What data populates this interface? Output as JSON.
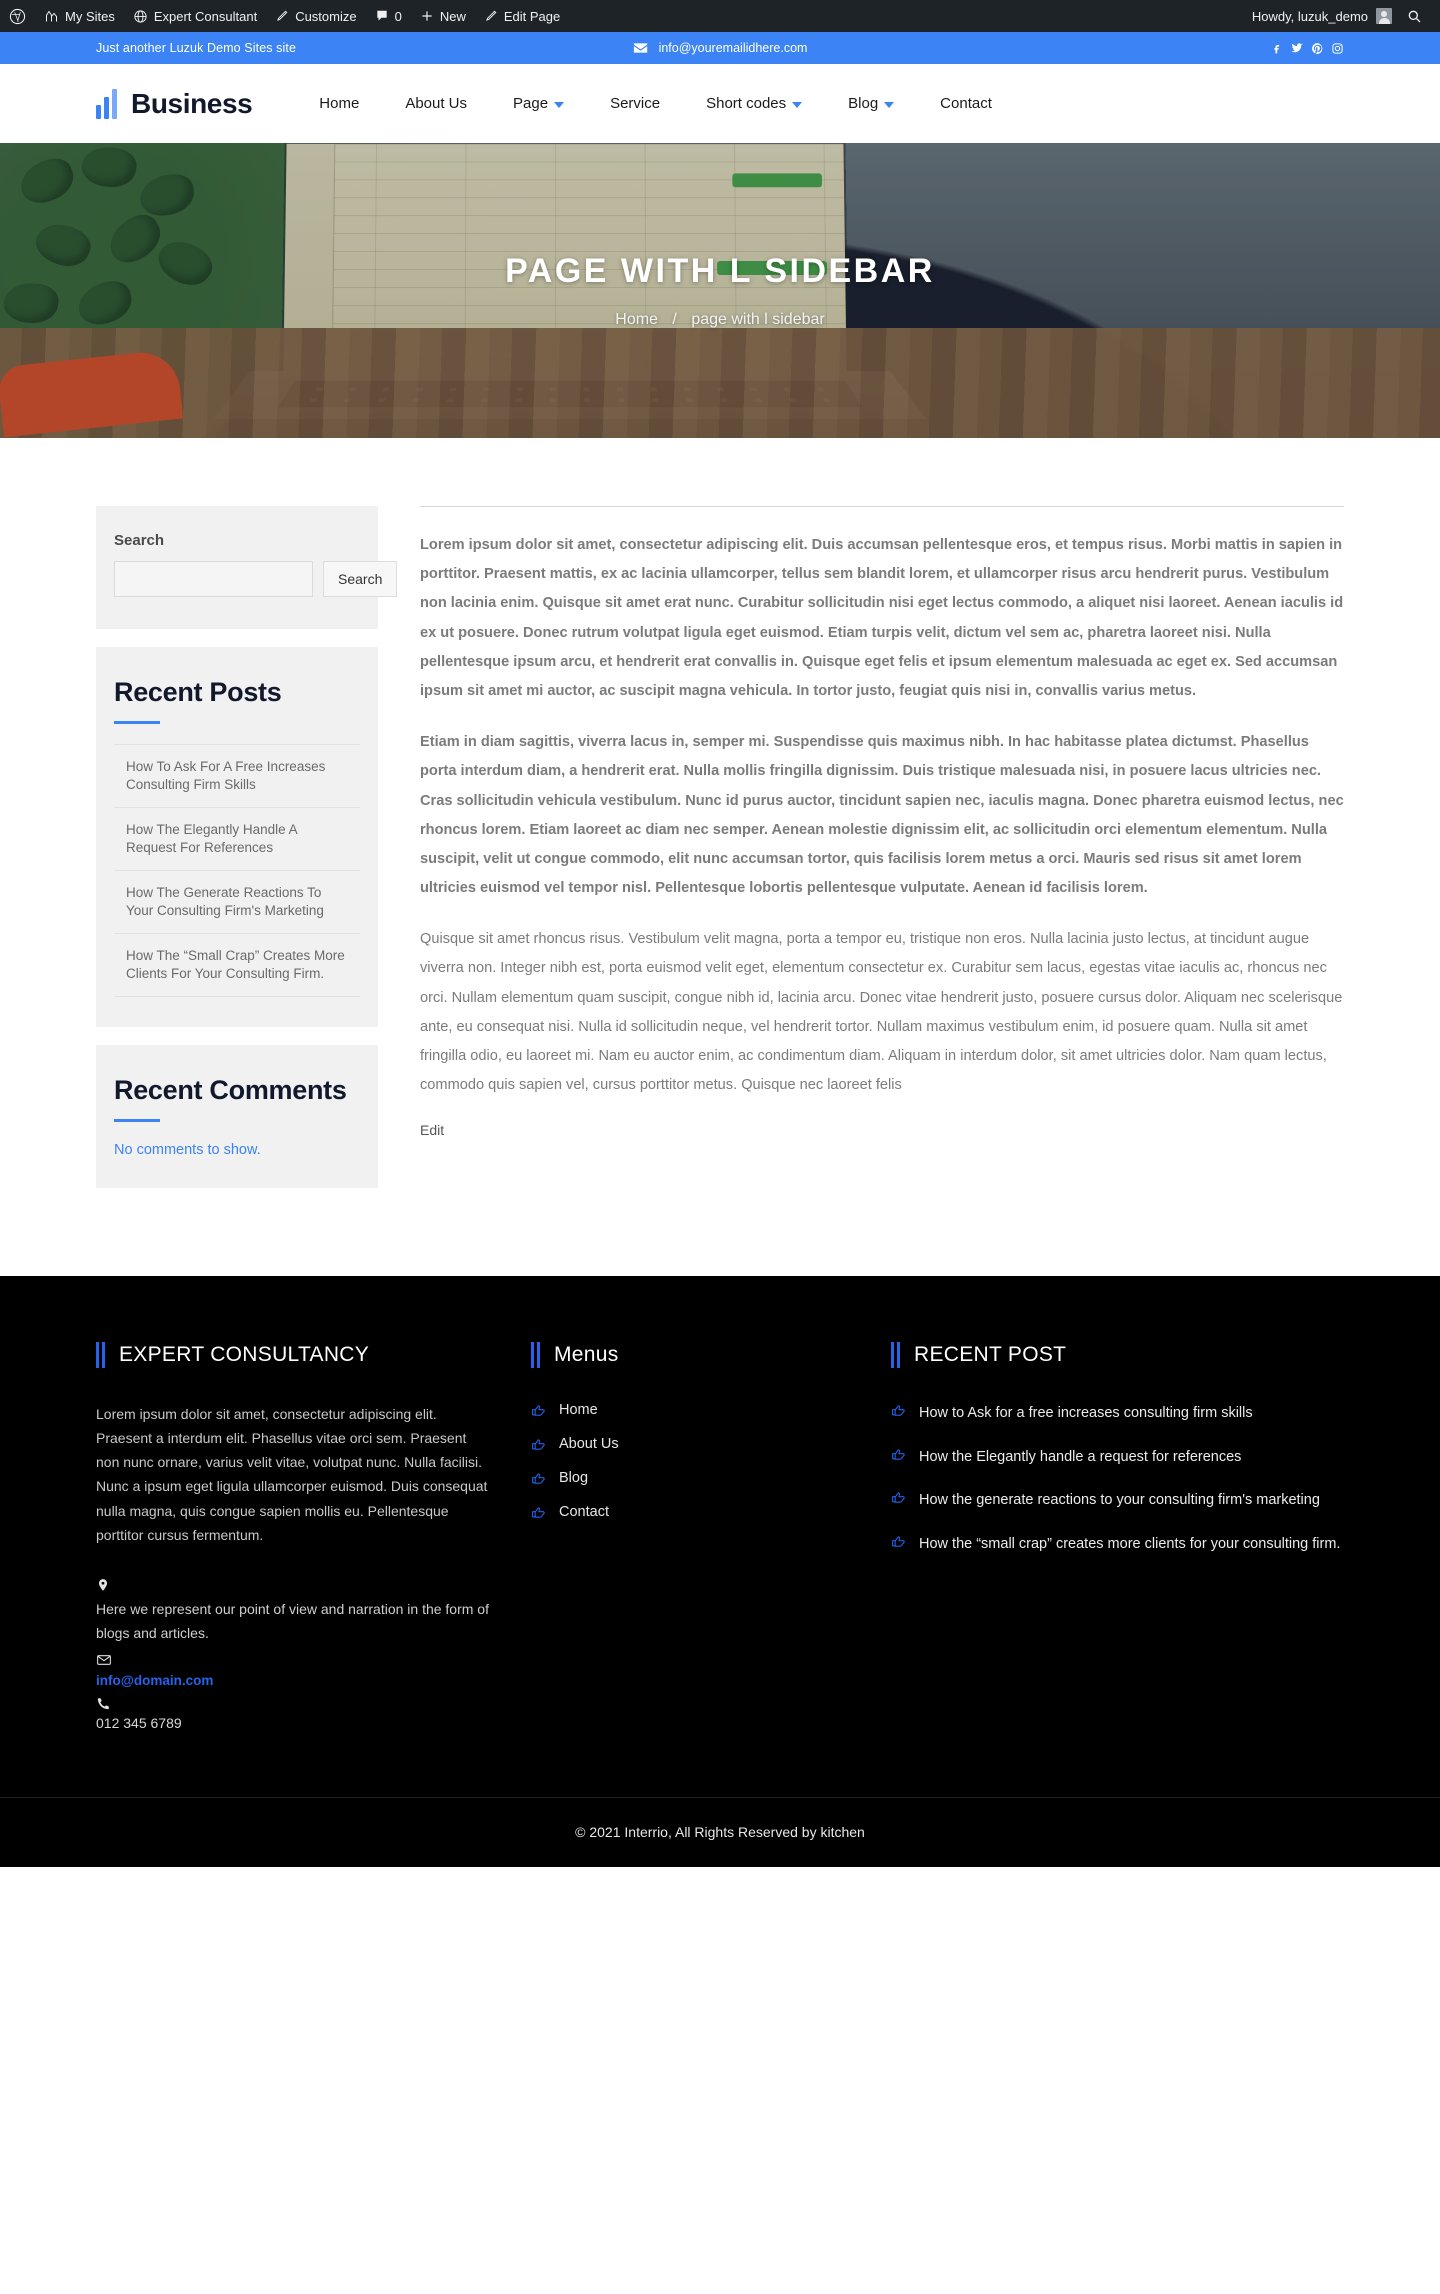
{
  "adminbar": {
    "items": [
      {
        "icon": "wordpress-icon",
        "label": ""
      },
      {
        "icon": "my-sites-icon",
        "label": "My Sites"
      },
      {
        "icon": "site-icon",
        "label": "Expert Consultant"
      },
      {
        "icon": "customize-pencil-icon",
        "label": "Customize"
      },
      {
        "icon": "comment-bubble-icon",
        "label": "0"
      },
      {
        "icon": "plus-icon",
        "label": "New"
      },
      {
        "icon": "edit-pencil-icon",
        "label": "Edit Page"
      }
    ],
    "howdy": "Howdy, luzuk_demo",
    "search_icon": "search-icon"
  },
  "topbar": {
    "tagline": "Just another Luzuk Demo Sites site",
    "email": "info@youremailidhere.com",
    "email_icon": "envelope-icon",
    "socials": [
      {
        "name": "facebook-icon",
        "glyph": "f"
      },
      {
        "name": "twitter-icon",
        "glyph": "t"
      },
      {
        "name": "pinterest-icon",
        "glyph": "p"
      },
      {
        "name": "instagram-icon",
        "glyph": "i"
      }
    ]
  },
  "header": {
    "brand": "Business",
    "nav": [
      {
        "label": "Home",
        "dropdown": false
      },
      {
        "label": "About Us",
        "dropdown": false
      },
      {
        "label": "Page",
        "dropdown": true
      },
      {
        "label": "Service",
        "dropdown": false
      },
      {
        "label": "Short codes",
        "dropdown": true
      },
      {
        "label": "Blog",
        "dropdown": true
      },
      {
        "label": "Contact",
        "dropdown": false
      }
    ]
  },
  "hero": {
    "title": "PAGE WITH L SIDEBAR",
    "breadcrumb_home": "Home",
    "breadcrumb_sep": "/",
    "breadcrumb_current": "page with l sidebar"
  },
  "sidebar": {
    "search": {
      "label": "Search",
      "value": "",
      "placeholder": "",
      "button": "Search"
    },
    "recent_posts": {
      "title": "Recent Posts",
      "items": [
        "How To Ask For A Free Increases Consulting Firm Skills",
        "How The Elegantly Handle A Request For References",
        "How The Generate Reactions To Your Consulting Firm's Marketing",
        "How The “Small Crap” Creates More Clients For Your Consulting Firm."
      ]
    },
    "recent_comments": {
      "title": "Recent Comments",
      "empty": "No comments to show."
    }
  },
  "content": {
    "paragraphs": [
      "Lorem ipsum dolor sit amet, consectetur adipiscing elit. Duis accumsan pellentesque eros, et tempus risus. Morbi mattis in sapien in porttitor. Praesent mattis, ex ac lacinia ullamcorper, tellus sem blandit lorem, et ullamcorper risus arcu hendrerit purus. Vestibulum non lacinia enim. Quisque sit amet erat nunc. Curabitur sollicitudin nisi eget lectus commodo, a aliquet nisi laoreet. Aenean iaculis id ex ut posuere. Donec rutrum volutpat ligula eget euismod. Etiam turpis velit, dictum vel sem ac, pharetra laoreet nisi. Nulla pellentesque ipsum arcu, et hendrerit erat convallis in. Quisque eget felis et ipsum elementum malesuada ac eget ex. Sed accumsan ipsum sit amet mi auctor, ac suscipit magna vehicula. In tortor justo, feugiat quis nisi in, convallis varius metus.",
      "Etiam in diam sagittis, viverra lacus in, semper mi. Suspendisse quis maximus nibh. In hac habitasse platea dictumst. Phasellus porta interdum diam, a hendrerit erat. Nulla mollis fringilla dignissim. Duis tristique malesuada nisi, in posuere lacus ultricies nec. Cras sollicitudin vehicula vestibulum. Nunc id purus auctor, tincidunt sapien nec, iaculis magna. Donec pharetra euismod lectus, nec rhoncus lorem. Etiam laoreet ac diam nec semper. Aenean molestie dignissim elit, ac sollicitudin orci elementum elementum. Nulla suscipit, velit ut congue commodo, elit nunc accumsan tortor, quis facilisis lorem metus a orci. Mauris sed risus sit amet lorem ultricies euismod vel tempor nisl. Pellentesque lobortis pellentesque vulputate. Aenean id facilisis lorem.",
      "Quisque sit amet rhoncus risus. Vestibulum velit magna, porta a tempor eu, tristique non eros. Nulla lacinia justo lectus, at tincidunt augue viverra non. Integer nibh est, porta euismod velit eget, elementum consectetur ex. Curabitur sem lacus, egestas vitae iaculis ac, rhoncus nec orci. Nullam elementum quam suscipit, congue nibh id, lacinia arcu. Donec vitae hendrerit justo, posuere cursus dolor. Aliquam nec scelerisque ante, eu consequat nisi. Nulla id sollicitudin neque, vel hendrerit tortor. Nullam maximus vestibulum enim, id posuere quam. Nulla sit amet fringilla odio, eu laoreet mi. Nam eu auctor enim, ac condimentum diam. Aliquam in interdum dolor, sit amet ultricies dolor. Nam quam lectus, commodo quis sapien vel, cursus porttitor metus. Quisque nec laoreet felis"
    ],
    "edit_link": "Edit"
  },
  "footer": {
    "col1": {
      "title": "EXPERT CONSULTANCY",
      "about": "Lorem ipsum dolor sit amet, consectetur adipiscing elit. Praesent a interdum elit. Phasellus vitae orci sem. Praesent non nunc ornare, varius velit vitae, volutpat nunc. Nulla facilisi. Nunc a ipsum eget ligula ullamcorper euismod. Duis consequat nulla magna, quis congue sapien mollis eu. Pellentesque porttitor cursus fermentum.",
      "address_icon": "location-pin-icon",
      "address": "Here we represent our point of view and narration in the form of blogs and articles.",
      "email_icon": "envelope-icon",
      "email": "info@domain.com",
      "phone_icon": "phone-icon",
      "phone": "012 345 6789"
    },
    "col2": {
      "title": "Menus",
      "items": [
        "Home",
        "About Us",
        "Blog",
        "Contact"
      ]
    },
    "col3": {
      "title": "RECENT POST",
      "items": [
        "How to Ask for a free increases consulting firm skills",
        "How the Elegantly handle a request for references",
        "How the generate reactions to your consulting firm's marketing",
        "How the “small crap” creates more clients for your consulting firm."
      ]
    },
    "copyright": "© 2021 Interrio, All Rights Reserved by kitchen"
  },
  "colors": {
    "accent_blue": "#3c84f5",
    "footer_blue": "#2563eb",
    "dark_navy": "#12192c",
    "adminbar": "#1d2327",
    "footer_bg": "#000000"
  }
}
